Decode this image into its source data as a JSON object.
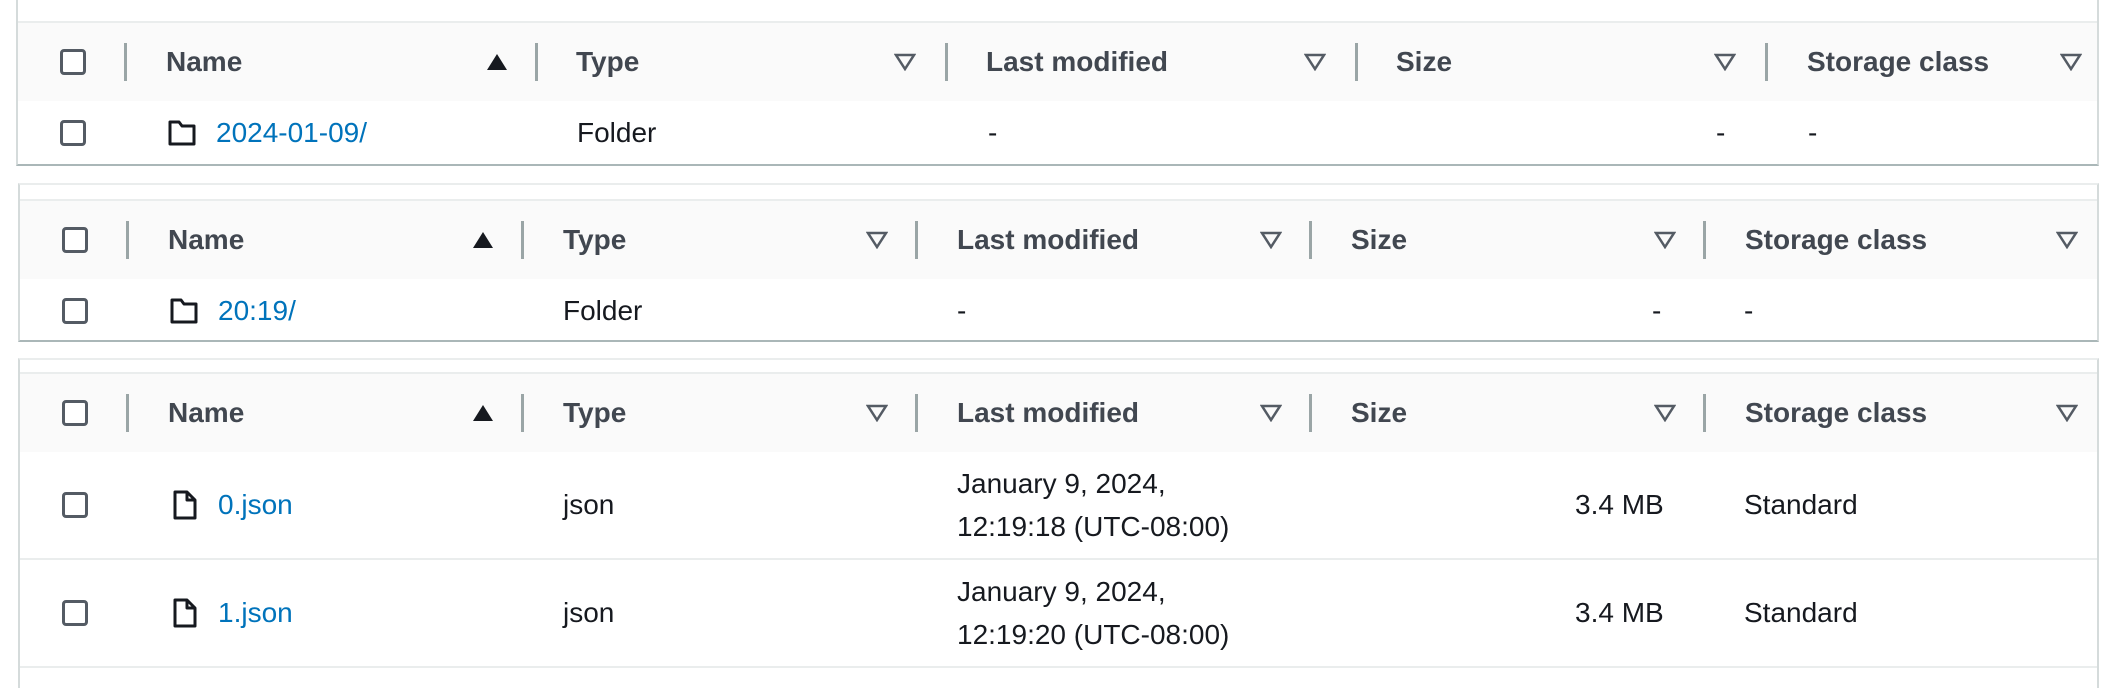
{
  "columns": {
    "name": "Name",
    "type": "Type",
    "last_modified": "Last modified",
    "size": "Size",
    "storage_class": "Storage class"
  },
  "sort_icons": {
    "name": "sort-ascending-icon",
    "others": "sort-descending-outline-icon"
  },
  "tables": [
    {
      "rows": [
        {
          "icon": "folder-icon",
          "name": "2024-01-09/",
          "type": "Folder",
          "last_modified": "-",
          "size": "-",
          "storage_class": "-"
        }
      ]
    },
    {
      "rows": [
        {
          "icon": "folder-icon",
          "name": "20:19/",
          "type": "Folder",
          "last_modified": "-",
          "size": "-",
          "storage_class": "-"
        }
      ]
    },
    {
      "rows": [
        {
          "icon": "file-icon",
          "name": "0.json",
          "type": "json",
          "last_modified_line1": "January 9, 2024,",
          "last_modified_line2": "12:19:18 (UTC-08:00)",
          "size": "3.4 MB",
          "storage_class": "Standard"
        },
        {
          "icon": "file-icon",
          "name": "1.json",
          "type": "json",
          "last_modified_line1": "January 9, 2024,",
          "last_modified_line2": "12:19:20 (UTC-08:00)",
          "size": "3.4 MB",
          "storage_class": "Standard"
        }
      ]
    }
  ],
  "colors": {
    "link": "#0073bb",
    "header_bg": "#fafafa",
    "border": "#eaeded",
    "text": "#16191f"
  }
}
